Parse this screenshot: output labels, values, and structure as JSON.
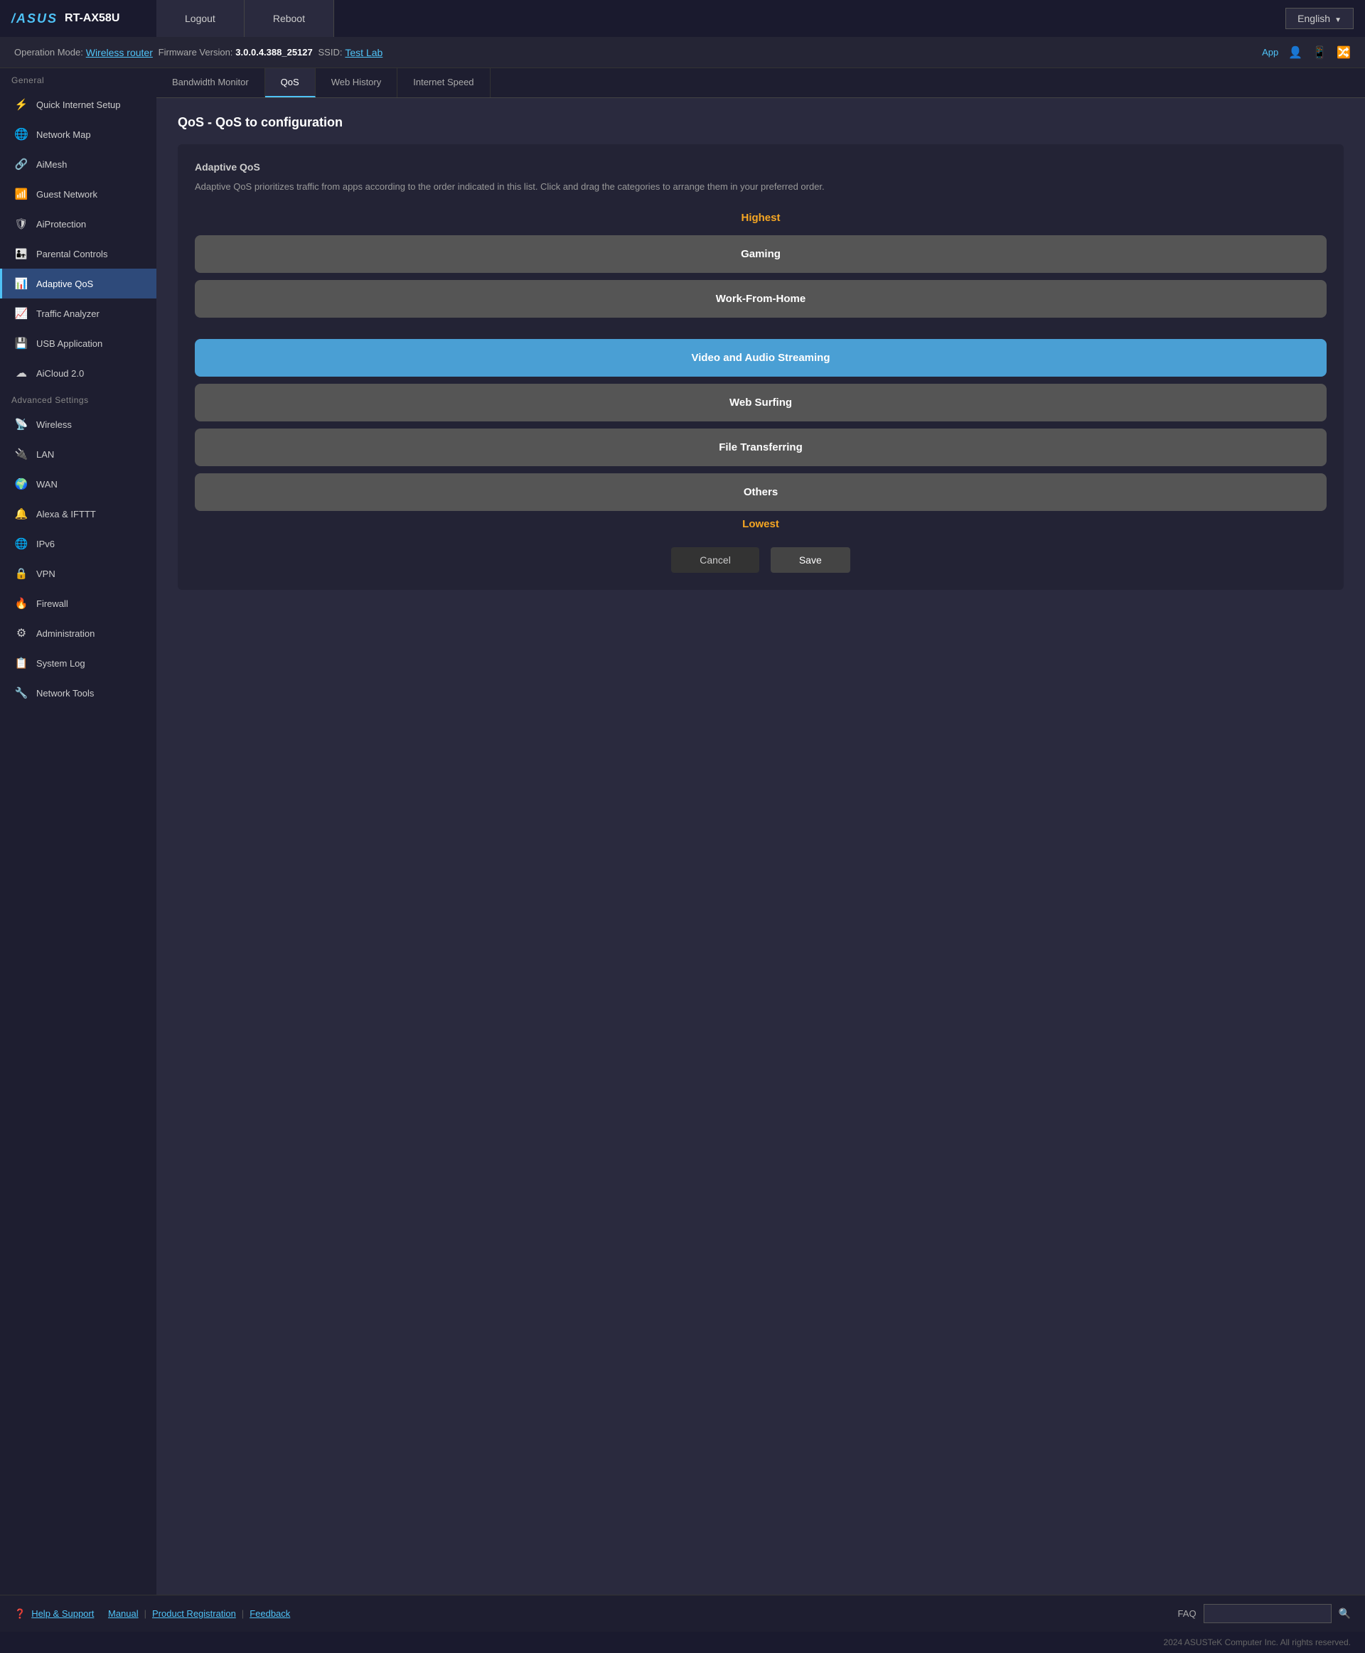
{
  "brand": {
    "logo": "/ASUS",
    "model": "RT-AX58U"
  },
  "topNav": {
    "logout_label": "Logout",
    "reboot_label": "Reboot",
    "language_label": "English"
  },
  "statusBar": {
    "operation_mode_label": "Operation Mode:",
    "operation_mode_value": "Wireless router",
    "firmware_label": "Firmware Version:",
    "firmware_value": "3.0.0.4.388_25127",
    "ssid_label": "SSID:",
    "ssid_value": "Test Lab",
    "app_link": "App"
  },
  "sidebar": {
    "general_label": "General",
    "items_general": [
      {
        "id": "quick-internet-setup",
        "icon": "icon-quick",
        "label": "Quick Internet Setup"
      },
      {
        "id": "network-map",
        "icon": "icon-globe",
        "label": "Network Map"
      },
      {
        "id": "aimesh",
        "icon": "icon-mesh",
        "label": "AiMesh"
      },
      {
        "id": "guest-network",
        "icon": "icon-wifi",
        "label": "Guest Network"
      },
      {
        "id": "aiprotection",
        "icon": "icon-shield",
        "label": "AiProtection"
      },
      {
        "id": "parental-controls",
        "icon": "icon-parent",
        "label": "Parental Controls"
      },
      {
        "id": "adaptive-qos",
        "icon": "icon-qos",
        "label": "Adaptive QoS",
        "active": true
      },
      {
        "id": "traffic-analyzer",
        "icon": "icon-traffic",
        "label": "Traffic Analyzer"
      },
      {
        "id": "usb-application",
        "icon": "icon-usb",
        "label": "USB Application"
      },
      {
        "id": "aicloud",
        "icon": "icon-cloud",
        "label": "AiCloud 2.0"
      }
    ],
    "advanced_label": "Advanced Settings",
    "items_advanced": [
      {
        "id": "wireless",
        "icon": "icon-wireless",
        "label": "Wireless"
      },
      {
        "id": "lan",
        "icon": "icon-lan",
        "label": "LAN"
      },
      {
        "id": "wan",
        "icon": "icon-wan",
        "label": "WAN"
      },
      {
        "id": "alexa-ifttt",
        "icon": "icon-alexa",
        "label": "Alexa & IFTTT"
      },
      {
        "id": "ipv6",
        "icon": "icon-ipv6",
        "label": "IPv6"
      },
      {
        "id": "vpn",
        "icon": "icon-vpn",
        "label": "VPN"
      },
      {
        "id": "firewall",
        "icon": "icon-firewall",
        "label": "Firewall"
      },
      {
        "id": "administration",
        "icon": "icon-admin",
        "label": "Administration"
      },
      {
        "id": "system-log",
        "icon": "icon-log",
        "label": "System Log"
      },
      {
        "id": "network-tools",
        "icon": "icon-tools",
        "label": "Network Tools"
      }
    ]
  },
  "tabs": [
    {
      "id": "bandwidth-monitor",
      "label": "Bandwidth Monitor",
      "active": false
    },
    {
      "id": "qos",
      "label": "QoS",
      "active": true
    },
    {
      "id": "web-history",
      "label": "Web History",
      "active": false
    },
    {
      "id": "internet-speed",
      "label": "Internet Speed",
      "active": false
    }
  ],
  "page": {
    "title": "QoS - QoS to configuration",
    "card": {
      "section_title": "Adaptive QoS",
      "description": "Adaptive QoS prioritizes traffic from apps according to the order indicated in this list. Click and drag the categories to arrange them in your preferred order.",
      "highest_label": "Highest",
      "lowest_label": "Lowest",
      "categories": [
        {
          "id": "gaming",
          "label": "Gaming",
          "highlighted": false,
          "position": 1
        },
        {
          "id": "work-from-home",
          "label": "Work-From-Home",
          "highlighted": false,
          "position": 2
        },
        {
          "id": "video-audio-streaming",
          "label": "Video and Audio Streaming",
          "highlighted": true,
          "position": 3
        },
        {
          "id": "web-surfing",
          "label": "Web Surfing",
          "highlighted": false,
          "position": 4
        },
        {
          "id": "file-transferring",
          "label": "File Transferring",
          "highlighted": false,
          "position": 5
        },
        {
          "id": "others",
          "label": "Others",
          "highlighted": false,
          "position": 6
        }
      ],
      "cancel_label": "Cancel",
      "save_label": "Save"
    }
  },
  "footer": {
    "help_label": "Help & Support",
    "manual_label": "Manual",
    "product_reg_label": "Product Registration",
    "feedback_label": "Feedback",
    "faq_label": "FAQ",
    "search_placeholder": ""
  },
  "copyright": "2024 ASUSTeK Computer Inc. All rights reserved."
}
